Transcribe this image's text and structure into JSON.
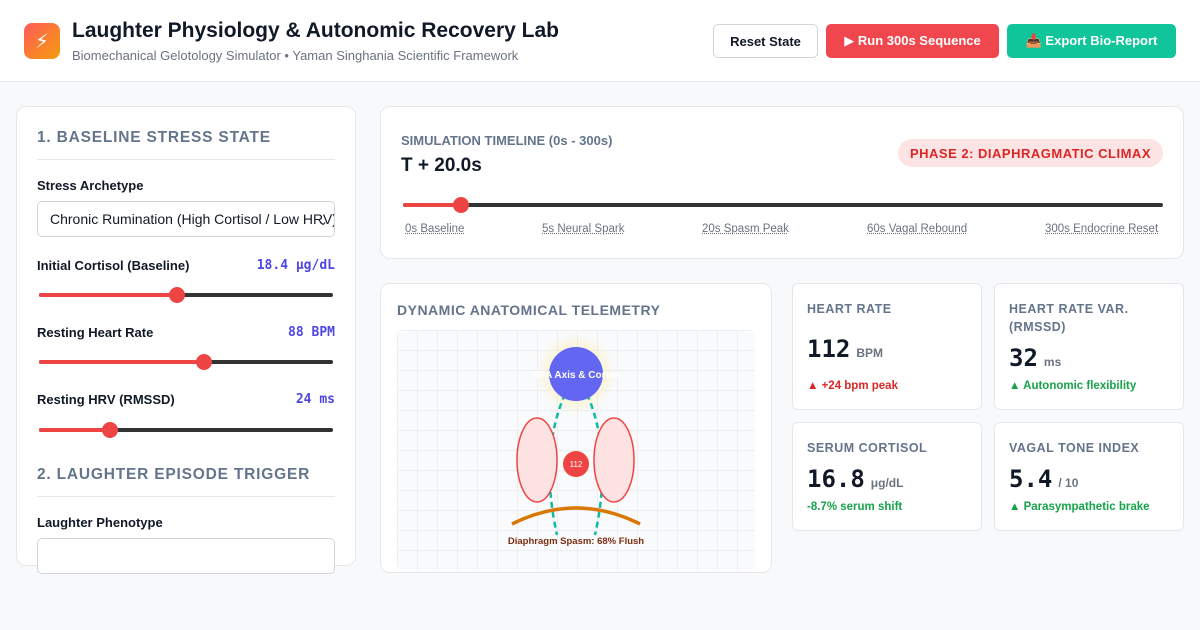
{
  "header": {
    "logo_icon": "lightning-bolt-icon",
    "title": "Laughter Physiology & Autonomic Recovery Lab",
    "subtitle": "Biomechanical Gelotology Simulator • Yaman Singhania Scientific Framework",
    "reset_label": "Reset State",
    "run_label": "▶ Run 300s Sequence",
    "export_label": "📥 Export Bio-Report"
  },
  "left": {
    "section1": "1. BASELINE STRESS STATE",
    "archetype_label": "Stress Archetype",
    "archetype_value": "Chronic Rumination (High Cortisol / Low HRV)",
    "cortisol_label": "Initial Cortisol (Baseline)",
    "cortisol_value": "18.4 μg/dL",
    "cortisol_level": 0.47,
    "hr_label": "Resting Heart Rate",
    "hr_value": "88 BPM",
    "hr_level": 0.56,
    "hrv_label": "Resting HRV (RMSSD)",
    "hrv_value": "24 ms",
    "hrv_level": 0.24,
    "section2": "2. LAUGHTER EPISODE TRIGGER",
    "phenotype_label": "Laughter Phenotype"
  },
  "timeline": {
    "label": "SIMULATION TIMELINE (0s - 300s)",
    "time": "T + 20.0s",
    "phase": "PHASE 2: DIAPHRAGMATIC CLIMAX",
    "level": 0.076,
    "ticks": [
      "0s Baseline",
      "5s Neural Spark",
      "20s Spasm Peak",
      "60s Vagal Rebound",
      "300s Endocrine Reset"
    ]
  },
  "telemetry": {
    "title": "DYNAMIC ANATOMICAL TELEMETRY",
    "brain_label": "HPA Axis & Cortex",
    "heart_label": "112",
    "diaphragm_label": "Diaphragm Spasm: 68% Flush"
  },
  "metrics": {
    "hr": {
      "title": "HEART RATE",
      "value": "112",
      "unit": "BPM",
      "delta": "▲ +24 bpm peak"
    },
    "hrv": {
      "title": "HEART RATE VAR. (RMSSD)",
      "value": "32",
      "unit": "ms",
      "delta": "▲ Autonomic flexibility"
    },
    "cortisol": {
      "title": "SERUM CORTISOL",
      "value": "16.8",
      "unit": "μg/dL",
      "delta": "-8.7% serum shift"
    },
    "vagal": {
      "title": "VAGAL TONE INDEX",
      "value": "5.4",
      "unit": "/ 10",
      "delta": "▲ Parasympathetic brake"
    }
  },
  "colors": {
    "accent_red": "#ef4444",
    "accent_green": "#10c59a",
    "accent_indigo": "#4f46e5"
  }
}
